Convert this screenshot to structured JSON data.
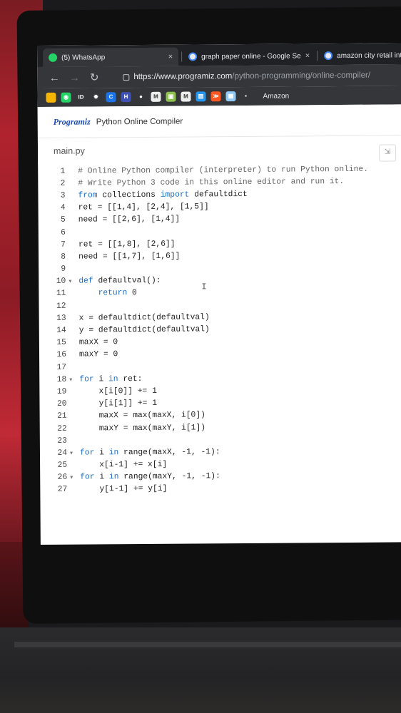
{
  "tabs": [
    {
      "title": "(5) WhatsApp",
      "icon": "whatsapp-icon",
      "color": "#25d366",
      "close": "×"
    },
    {
      "title": "graph paper online - Google Se",
      "icon": "google-icon",
      "color": "#e8eaed",
      "close": "×"
    },
    {
      "title": "amazon city retail int",
      "icon": "google-icon",
      "color": "#e8eaed"
    }
  ],
  "address": {
    "domain": "https://www.programiz.com",
    "path": "/python-programming/online-compiler/"
  },
  "bookmarks": {
    "items": [
      {
        "icon": "bookmark-icon",
        "color": "#f4b400",
        "glyph": ""
      },
      {
        "icon": "whatsapp-icon",
        "color": "#25d366",
        "glyph": "◉"
      },
      {
        "icon": "id-icon",
        "color": "#35363a",
        "glyph": "ID"
      },
      {
        "icon": "gear-icon",
        "color": "#35363a",
        "glyph": "✹"
      },
      {
        "icon": "c-icon",
        "color": "#1a73e8",
        "glyph": "C"
      },
      {
        "icon": "h-icon",
        "color": "#3f51b5",
        "glyph": "H"
      },
      {
        "icon": "github-icon",
        "color": "#35363a",
        "glyph": "●"
      },
      {
        "icon": "m-icon",
        "color": "#eeeeee",
        "glyph": "M"
      },
      {
        "icon": "bookmark-icon",
        "color": "#8bc34a",
        "glyph": "▣"
      },
      {
        "icon": "m-icon",
        "color": "#eeeeee",
        "glyph": "M"
      },
      {
        "icon": "bookmark-icon",
        "color": "#2196f3",
        "glyph": "▤"
      },
      {
        "icon": "bookmark-icon",
        "color": "#ff5722",
        "glyph": "≫"
      },
      {
        "icon": "bookmark-icon",
        "color": "#90caf9",
        "glyph": "▦"
      },
      {
        "icon": "bookmark-icon",
        "color": "#35363a",
        "glyph": "▪"
      }
    ],
    "amazon_label": "Amazon"
  },
  "app": {
    "logo": "Programiz",
    "title": "Python Online Compiler"
  },
  "editor": {
    "filename": "main.py",
    "lines": [
      {
        "n": "1",
        "fold": "",
        "segs": [
          [
            "cm",
            "# Online Python compiler (interpreter) to run Python online."
          ]
        ]
      },
      {
        "n": "2",
        "fold": "",
        "segs": [
          [
            "cm",
            "# Write Python 3 code in this online editor and run it."
          ]
        ]
      },
      {
        "n": "3",
        "fold": "",
        "segs": [
          [
            "kw",
            "from"
          ],
          [
            "nm",
            " collections "
          ],
          [
            "kw",
            "import"
          ],
          [
            "nm",
            " defaultdict"
          ]
        ]
      },
      {
        "n": "4",
        "fold": "",
        "segs": [
          [
            "nm",
            "ret = [[1,4], [2,4], [1,5]]"
          ]
        ]
      },
      {
        "n": "5",
        "fold": "",
        "segs": [
          [
            "nm",
            "need = [[2,6], [1,4]]"
          ]
        ]
      },
      {
        "n": "6",
        "fold": "",
        "segs": [
          [
            "nm",
            ""
          ]
        ]
      },
      {
        "n": "7",
        "fold": "",
        "segs": [
          [
            "nm",
            "ret = [[1,8], [2,6]]"
          ]
        ]
      },
      {
        "n": "8",
        "fold": "",
        "segs": [
          [
            "nm",
            "need = [[1,7], [1,6]]"
          ]
        ]
      },
      {
        "n": "9",
        "fold": "",
        "segs": [
          [
            "nm",
            ""
          ]
        ]
      },
      {
        "n": "10",
        "fold": "▾",
        "segs": [
          [
            "kw",
            "def"
          ],
          [
            "nm",
            " defaultval():"
          ]
        ]
      },
      {
        "n": "11",
        "fold": "",
        "segs": [
          [
            "nm",
            "    "
          ],
          [
            "kw",
            "return"
          ],
          [
            "nm",
            " 0"
          ]
        ]
      },
      {
        "n": "12",
        "fold": "",
        "segs": [
          [
            "nm",
            ""
          ]
        ]
      },
      {
        "n": "13",
        "fold": "",
        "segs": [
          [
            "nm",
            "x = defaultdict(defaultval)"
          ]
        ]
      },
      {
        "n": "14",
        "fold": "",
        "segs": [
          [
            "nm",
            "y = defaultdict(defaultval)"
          ]
        ]
      },
      {
        "n": "15",
        "fold": "",
        "segs": [
          [
            "nm",
            "maxX = 0"
          ]
        ]
      },
      {
        "n": "16",
        "fold": "",
        "segs": [
          [
            "nm",
            "maxY = 0"
          ]
        ]
      },
      {
        "n": "17",
        "fold": "",
        "segs": [
          [
            "nm",
            ""
          ]
        ]
      },
      {
        "n": "18",
        "fold": "▾",
        "segs": [
          [
            "kw",
            "for"
          ],
          [
            "nm",
            " i "
          ],
          [
            "kw",
            "in"
          ],
          [
            "nm",
            " ret:"
          ]
        ]
      },
      {
        "n": "19",
        "fold": "",
        "segs": [
          [
            "nm",
            "    x[i[0]] += 1"
          ]
        ]
      },
      {
        "n": "20",
        "fold": "",
        "segs": [
          [
            "nm",
            "    y[i[1]] += 1"
          ]
        ]
      },
      {
        "n": "21",
        "fold": "",
        "segs": [
          [
            "nm",
            "    maxX = max(maxX, i[0])"
          ]
        ]
      },
      {
        "n": "22",
        "fold": "",
        "segs": [
          [
            "nm",
            "    maxY = max(maxY, i[1])"
          ]
        ]
      },
      {
        "n": "23",
        "fold": "",
        "segs": [
          [
            "nm",
            ""
          ]
        ]
      },
      {
        "n": "24",
        "fold": "▾",
        "segs": [
          [
            "kw",
            "for"
          ],
          [
            "nm",
            " i "
          ],
          [
            "kw",
            "in"
          ],
          [
            "nm",
            " range(maxX, -1, -1):"
          ]
        ]
      },
      {
        "n": "25",
        "fold": "",
        "segs": [
          [
            "nm",
            "    x[i-1] += x[i]"
          ]
        ]
      },
      {
        "n": "26",
        "fold": "▾",
        "segs": [
          [
            "kw",
            "for"
          ],
          [
            "nm",
            " i "
          ],
          [
            "kw",
            "in"
          ],
          [
            "nm",
            " range(maxY, -1, -1):"
          ]
        ]
      },
      {
        "n": "27",
        "fold": "",
        "segs": [
          [
            "nm",
            "    y[i-1] += y[i]"
          ]
        ]
      }
    ]
  }
}
